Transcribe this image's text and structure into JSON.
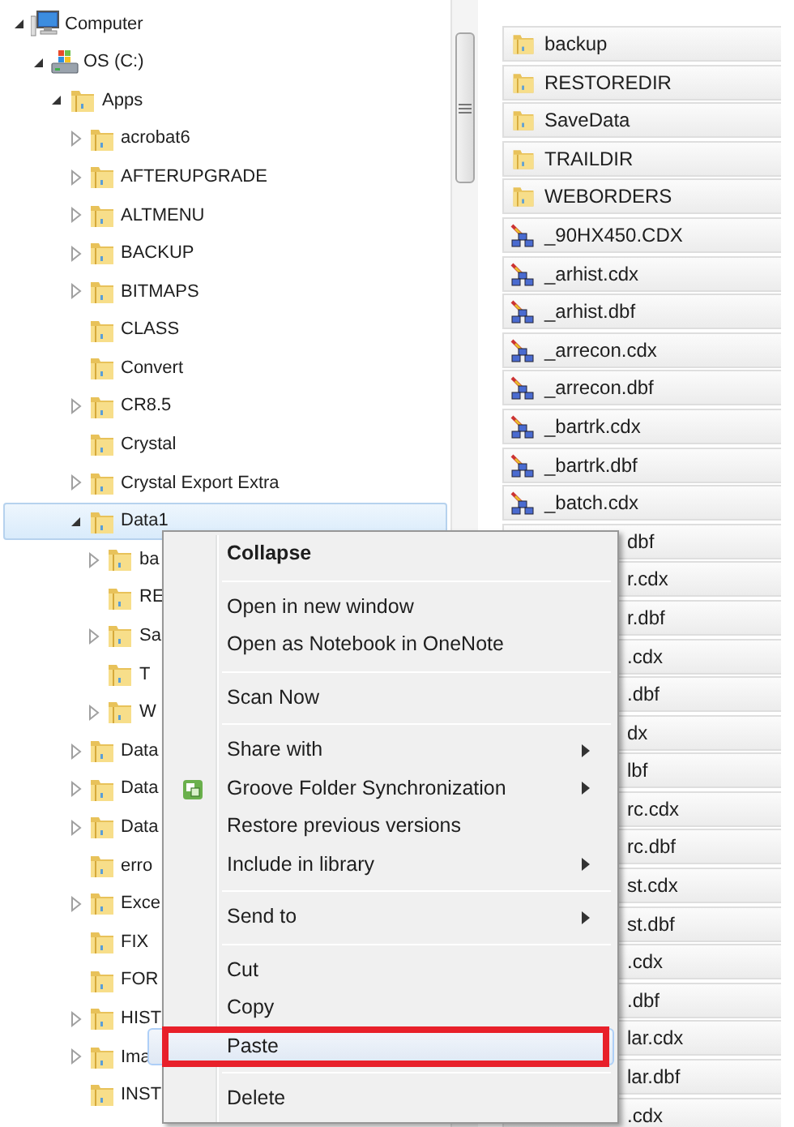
{
  "tree": [
    {
      "label": "Computer",
      "expanded": true,
      "selected": false,
      "children": [
        {
          "label": "OS (C:)",
          "expanded": true,
          "selected": false,
          "children": [
            {
              "label": "Apps",
              "expanded": true,
              "selected": false,
              "children": [
                {
                  "label": "acrobat6",
                  "expanded": false,
                  "selected": false
                },
                {
                  "label": "AFTERUPGRADE",
                  "expanded": false,
                  "selected": false
                },
                {
                  "label": "ALTMENU",
                  "expanded": false,
                  "selected": false
                },
                {
                  "label": "BACKUP",
                  "expanded": false,
                  "selected": false
                },
                {
                  "label": "BITMAPS",
                  "expanded": false,
                  "selected": false
                },
                {
                  "label": "CLASS",
                  "selected": false
                },
                {
                  "label": "Convert",
                  "selected": false
                },
                {
                  "label": "CR8.5",
                  "expanded": false,
                  "selected": false
                },
                {
                  "label": "Crystal",
                  "selected": false
                },
                {
                  "label": "Crystal Export Extra",
                  "expanded": false,
                  "selected": false
                },
                {
                  "label": "Data1",
                  "expanded": true,
                  "selected": true,
                  "children": [
                    {
                      "label": "ba",
                      "expanded": false,
                      "selected": false
                    },
                    {
                      "label": "RE",
                      "selected": false
                    },
                    {
                      "label": "Sa",
                      "expanded": false,
                      "selected": false
                    },
                    {
                      "label": "T",
                      "selected": false
                    },
                    {
                      "label": "W",
                      "expanded": false,
                      "selected": false
                    }
                  ]
                },
                {
                  "label": "Data",
                  "expanded": false,
                  "selected": false
                },
                {
                  "label": "Data",
                  "expanded": false,
                  "selected": false
                },
                {
                  "label": "Data",
                  "expanded": false,
                  "selected": false
                },
                {
                  "label": "erro",
                  "selected": false
                },
                {
                  "label": "Exce",
                  "expanded": false,
                  "selected": false
                },
                {
                  "label": "FIX",
                  "selected": false
                },
                {
                  "label": "FOR",
                  "selected": false
                },
                {
                  "label": "HIST",
                  "expanded": false,
                  "selected": false
                },
                {
                  "label": "Ima",
                  "expanded": false,
                  "selected": false
                },
                {
                  "label": "INST",
                  "selected": false
                }
              ]
            }
          ]
        }
      ]
    }
  ],
  "files": [
    {
      "name": "backup",
      "kind": "folder"
    },
    {
      "name": "RESTOREDIR",
      "kind": "folder"
    },
    {
      "name": "SaveData",
      "kind": "folder"
    },
    {
      "name": "TRAILDIR",
      "kind": "folder"
    },
    {
      "name": "WEBORDERS",
      "kind": "folder"
    },
    {
      "name": "_90HX450.CDX",
      "kind": "file"
    },
    {
      "name": "_arhist.cdx",
      "kind": "file"
    },
    {
      "name": "_arhist.dbf",
      "kind": "file"
    },
    {
      "name": "_arrecon.cdx",
      "kind": "file"
    },
    {
      "name": "_arrecon.dbf",
      "kind": "file"
    },
    {
      "name": "_bartrk.cdx",
      "kind": "file"
    },
    {
      "name": "_bartrk.dbf",
      "kind": "file"
    },
    {
      "name": "_batch.cdx",
      "kind": "file"
    },
    {
      "name": "dbf",
      "kind": "partial"
    },
    {
      "name": "r.cdx",
      "kind": "partial"
    },
    {
      "name": "r.dbf",
      "kind": "partial"
    },
    {
      "name": ".cdx",
      "kind": "partial"
    },
    {
      "name": ".dbf",
      "kind": "partial"
    },
    {
      "name": "dx",
      "kind": "partial"
    },
    {
      "name": "lbf",
      "kind": "partial"
    },
    {
      "name": "rc.cdx",
      "kind": "partial"
    },
    {
      "name": "rc.dbf",
      "kind": "partial"
    },
    {
      "name": "st.cdx",
      "kind": "partial"
    },
    {
      "name": "st.dbf",
      "kind": "partial"
    },
    {
      "name": ".cdx",
      "kind": "partial"
    },
    {
      "name": ".dbf",
      "kind": "partial"
    },
    {
      "name": "lar.cdx",
      "kind": "partial"
    },
    {
      "name": "lar.dbf",
      "kind": "partial"
    },
    {
      "name": ".cdx",
      "kind": "partial"
    }
  ],
  "context_menu": [
    {
      "kind": "item",
      "label": "Collapse",
      "default": true,
      "submenu": false,
      "has_icon": false,
      "selected": false,
      "outlined": false
    },
    {
      "kind": "separator"
    },
    {
      "kind": "item",
      "label": "Open in new window",
      "default": false,
      "submenu": false,
      "has_icon": false,
      "selected": false,
      "outlined": false
    },
    {
      "kind": "item",
      "label": "Open as Notebook in OneNote",
      "default": false,
      "submenu": false,
      "has_icon": false,
      "selected": false,
      "outlined": false
    },
    {
      "kind": "separator"
    },
    {
      "kind": "item",
      "label": "Scan Now",
      "default": false,
      "submenu": false,
      "has_icon": false,
      "selected": false,
      "outlined": false
    },
    {
      "kind": "separator"
    },
    {
      "kind": "item",
      "label": "Share with",
      "default": false,
      "submenu": true,
      "has_icon": false,
      "selected": false,
      "outlined": false
    },
    {
      "kind": "item",
      "label": "Groove Folder Synchronization",
      "default": false,
      "submenu": true,
      "has_icon": true,
      "selected": false,
      "outlined": false
    },
    {
      "kind": "item",
      "label": "Restore previous versions",
      "default": false,
      "submenu": false,
      "has_icon": false,
      "selected": false,
      "outlined": false
    },
    {
      "kind": "item",
      "label": "Include in library",
      "default": false,
      "submenu": true,
      "has_icon": false,
      "selected": false,
      "outlined": false
    },
    {
      "kind": "separator"
    },
    {
      "kind": "item",
      "label": "Send to",
      "default": false,
      "submenu": true,
      "has_icon": false,
      "selected": false,
      "outlined": false
    },
    {
      "kind": "separator"
    },
    {
      "kind": "item",
      "label": "Cut",
      "default": false,
      "submenu": false,
      "has_icon": false,
      "selected": false,
      "outlined": false
    },
    {
      "kind": "item",
      "label": "Copy",
      "default": false,
      "submenu": false,
      "has_icon": false,
      "selected": false,
      "outlined": false
    },
    {
      "kind": "item",
      "label": "Paste",
      "default": false,
      "submenu": false,
      "has_icon": false,
      "selected": true,
      "outlined": true
    },
    {
      "kind": "separator"
    },
    {
      "kind": "item",
      "label": "Delete",
      "default": false,
      "submenu": false,
      "has_icon": false,
      "selected": false,
      "outlined": false
    }
  ]
}
